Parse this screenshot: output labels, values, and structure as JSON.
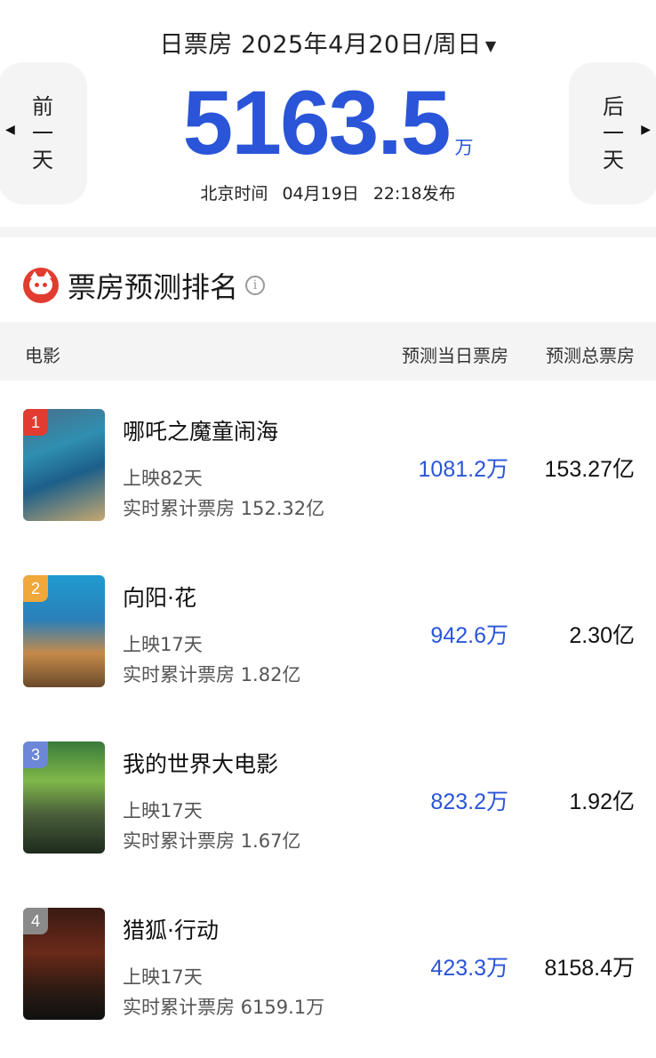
{
  "header": {
    "date_label": "日票房 2025年4月20日/周日",
    "prev_label": "前一天",
    "next_label": "后一天",
    "box_office_value": "5163.5",
    "box_office_unit": "万",
    "publish_prefix": "北京时间",
    "publish_date": "04月19日",
    "publish_time": "22:18发布"
  },
  "section": {
    "title": "票房预测排名"
  },
  "table": {
    "col_movie": "电影",
    "col_day": "预测当日票房",
    "col_total": "预测总票房"
  },
  "colors": {
    "accent_blue": "#2a55d8",
    "badge_red": "#e23c30",
    "badge_orange": "#f0a83a",
    "badge_blue": "#6c86d8",
    "badge_gray": "#8a8a8a"
  },
  "movies": [
    {
      "rank": "1",
      "name": "哪吒之魔童闹海",
      "days": "上映82天",
      "cumulative": "实时累计票房 152.32亿",
      "predicted_day": "1081.2",
      "predicted_day_unit": "万",
      "predicted_total": "153.27",
      "predicted_total_unit": "亿"
    },
    {
      "rank": "2",
      "name": "向阳·花",
      "days": "上映17天",
      "cumulative": "实时累计票房 1.82亿",
      "predicted_day": "942.6",
      "predicted_day_unit": "万",
      "predicted_total": "2.30",
      "predicted_total_unit": "亿"
    },
    {
      "rank": "3",
      "name": "我的世界大电影",
      "days": "上映17天",
      "cumulative": "实时累计票房 1.67亿",
      "predicted_day": "823.2",
      "predicted_day_unit": "万",
      "predicted_total": "1.92",
      "predicted_total_unit": "亿"
    },
    {
      "rank": "4",
      "name": "猎狐·行动",
      "days": "上映17天",
      "cumulative": "实时累计票房 6159.1万",
      "predicted_day": "423.3",
      "predicted_day_unit": "万",
      "predicted_total": "8158.4",
      "predicted_total_unit": "万"
    }
  ]
}
